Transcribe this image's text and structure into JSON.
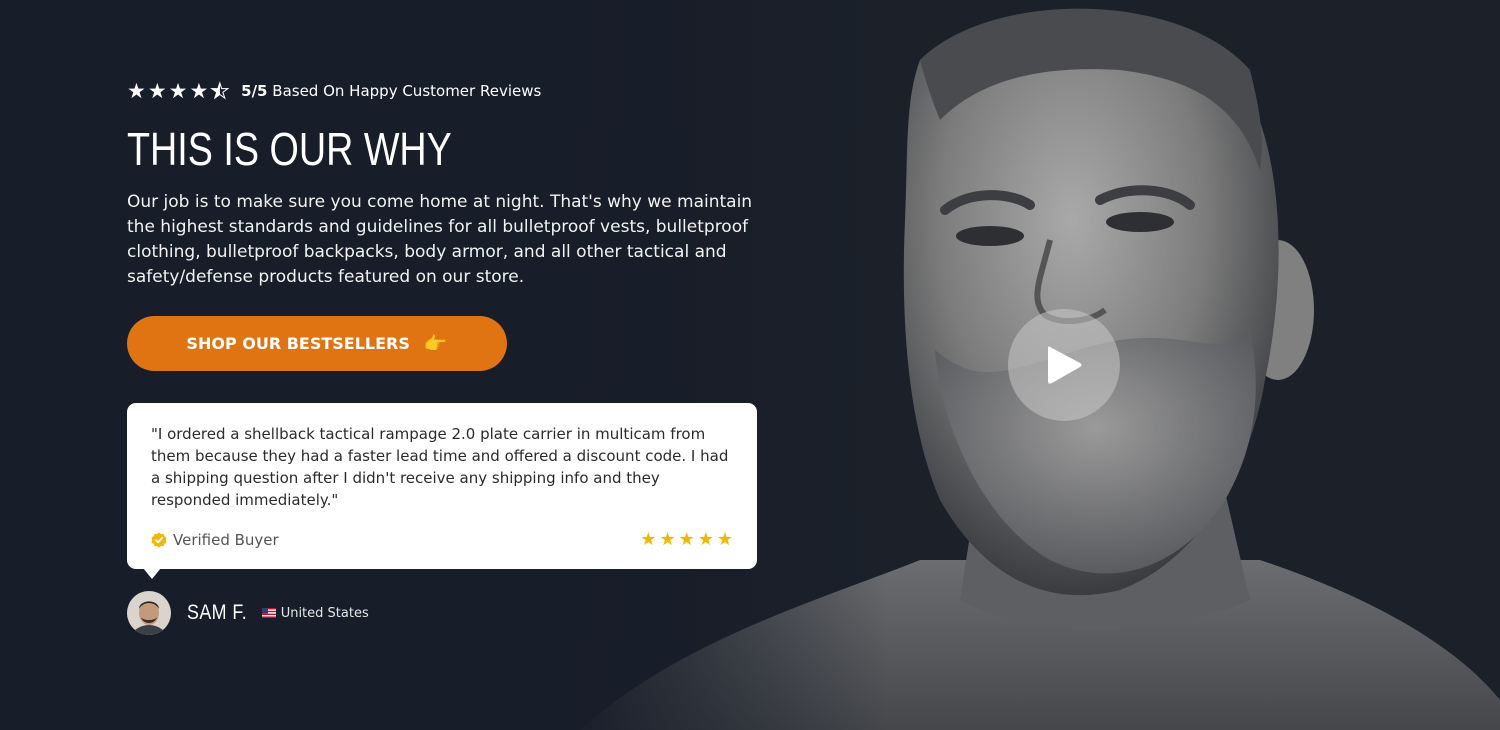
{
  "rating": {
    "score": "5/5",
    "text": "Based On Happy Customer Reviews",
    "stars_value": 4.5
  },
  "headline": "THIS IS OUR WHY",
  "description": "Our job is to make sure you come home at night. That's why we maintain the highest standards and guidelines for all bulletproof vests, bulletproof clothing, bulletproof backpacks, body armor, and all other tactical and safety/defense products featured on our store.",
  "cta": {
    "label": "SHOP OUR BESTSELLERS",
    "icon": "pointing-hand-icon",
    "color": "#e07412"
  },
  "review": {
    "quote": "\"I ordered a shellback tactical rampage 2.0 plate carrier in multicam from them because they had a faster lead time and offered a discount code. I had a shipping question after I didn't receive any shipping info and they responded immediately.\"",
    "verified_label": "Verified Buyer",
    "stars_value": 5,
    "star_color": "#f2b705"
  },
  "author": {
    "name": "SAM F.",
    "country": "United States",
    "flag_icon": "us-flag-icon"
  },
  "video": {
    "play_icon": "play-icon"
  },
  "colors": {
    "background": "#171d29",
    "accent": "#e07412"
  }
}
